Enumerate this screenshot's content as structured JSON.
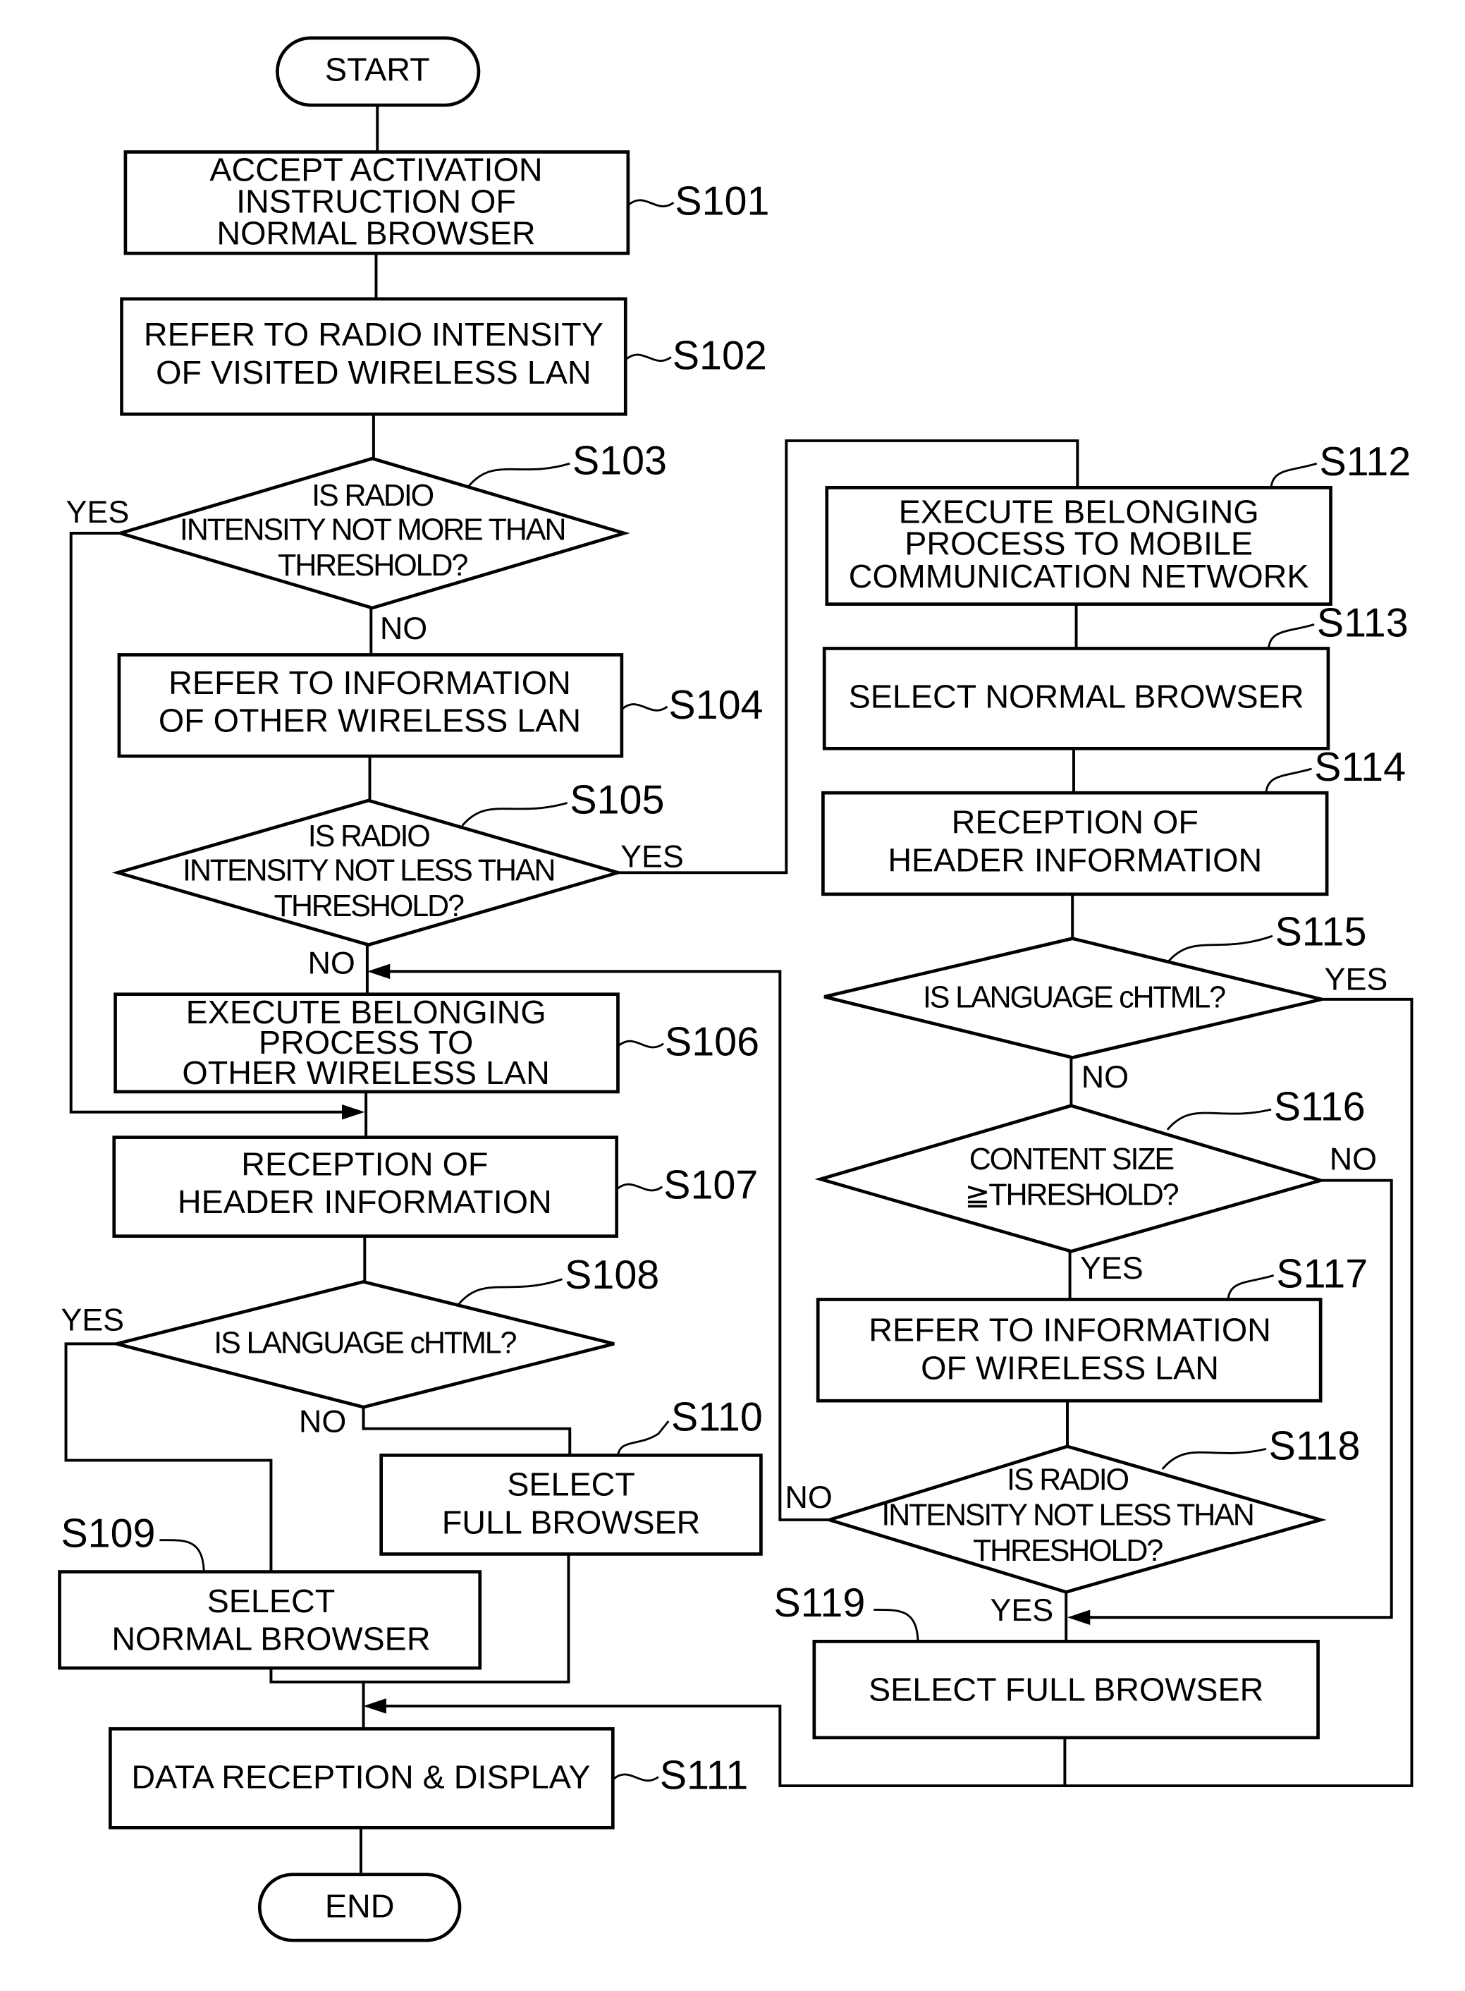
{
  "flowchart": {
    "terminals": {
      "start": "START",
      "end": "END"
    },
    "steps": {
      "S101": {
        "id": "S101",
        "lines": [
          "ACCEPT ACTIVATION",
          "INSTRUCTION OF",
          "NORMAL BROWSER"
        ]
      },
      "S102": {
        "id": "S102",
        "lines": [
          "REFER TO RADIO INTENSITY",
          "OF VISITED WIRELESS LAN"
        ]
      },
      "S103": {
        "id": "S103",
        "lines": [
          "IS RADIO",
          "INTENSITY NOT MORE THAN",
          "THRESHOLD?"
        ]
      },
      "S104": {
        "id": "S104",
        "lines": [
          "REFER TO INFORMATION",
          "OF OTHER WIRELESS LAN"
        ]
      },
      "S105": {
        "id": "S105",
        "lines": [
          "IS RADIO",
          "INTENSITY NOT LESS THAN",
          "THRESHOLD?"
        ]
      },
      "S106": {
        "id": "S106",
        "lines": [
          "EXECUTE BELONGING",
          "PROCESS TO",
          "OTHER WIRELESS LAN"
        ]
      },
      "S107": {
        "id": "S107",
        "lines": [
          "RECEPTION OF",
          "HEADER INFORMATION"
        ]
      },
      "S108": {
        "id": "S108",
        "lines": [
          "IS LANGUAGE cHTML?"
        ]
      },
      "S109": {
        "id": "S109",
        "lines": [
          "SELECT",
          "NORMAL BROWSER"
        ]
      },
      "S110": {
        "id": "S110",
        "lines": [
          "SELECT",
          "FULL BROWSER"
        ]
      },
      "S111": {
        "id": "S111",
        "lines": [
          "DATA RECEPTION & DISPLAY"
        ]
      },
      "S112": {
        "id": "S112",
        "lines": [
          "EXECUTE BELONGING",
          "PROCESS TO MOBILE",
          "COMMUNICATION NETWORK"
        ]
      },
      "S113": {
        "id": "S113",
        "lines": [
          "SELECT NORMAL BROWSER"
        ]
      },
      "S114": {
        "id": "S114",
        "lines": [
          "RECEPTION OF",
          "HEADER INFORMATION"
        ]
      },
      "S115": {
        "id": "S115",
        "lines": [
          "IS LANGUAGE cHTML?"
        ]
      },
      "S116": {
        "id": "S116",
        "lines": [
          "CONTENT SIZE",
          "≧THRESHOLD?"
        ]
      },
      "S117": {
        "id": "S117",
        "lines": [
          "REFER TO INFORMATION",
          "OF WIRELESS LAN"
        ]
      },
      "S118": {
        "id": "S118",
        "lines": [
          "IS RADIO",
          "INTENSITY NOT LESS THAN",
          "THRESHOLD?"
        ]
      },
      "S119": {
        "id": "S119",
        "lines": [
          "SELECT FULL BROWSER"
        ]
      }
    },
    "branch_labels": {
      "yes": "YES",
      "no": "NO"
    }
  }
}
